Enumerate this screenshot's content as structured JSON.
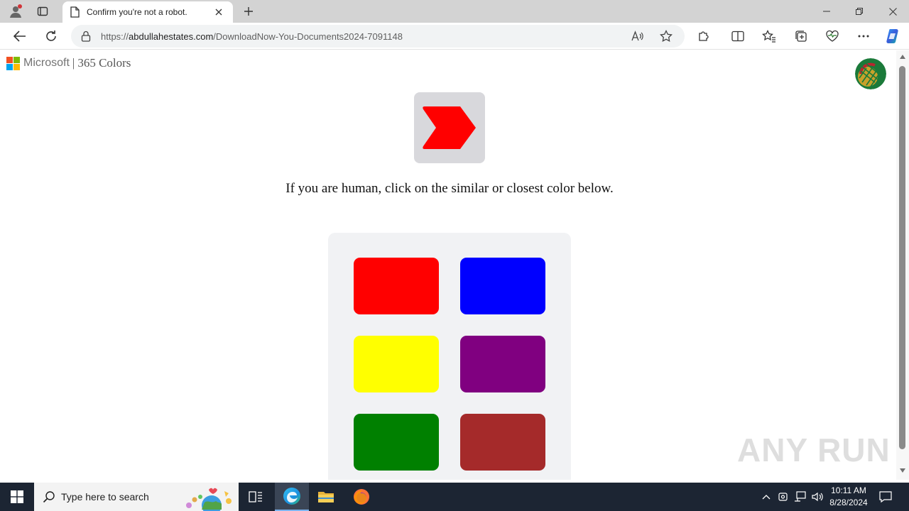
{
  "browser": {
    "tab": {
      "title": "Confirm you're not a robot."
    },
    "address": {
      "scheme": "https://",
      "domain": "abdullahestates.com",
      "path": "/DownloadNow-You-Documents2024-7091148"
    }
  },
  "page": {
    "brand": {
      "microsoft": "Microsoft",
      "separator": "|",
      "product": "365 Colors"
    },
    "prompt": "If you are human, click on the similar or closest color below.",
    "target_color": "#ff0000",
    "swatches": [
      {
        "color": "#ff0000"
      },
      {
        "color": "#0000ff"
      },
      {
        "color": "#ffff00"
      },
      {
        "color": "#800080"
      },
      {
        "color": "#008000"
      },
      {
        "color": "#a52a2a"
      }
    ],
    "watermark": "ANY RUN"
  },
  "taskbar": {
    "search_placeholder": "Type here to search",
    "time": "10:11 AM",
    "date": "8/28/2024"
  },
  "colors": {
    "accent": "#0078d4",
    "taskbar": "#1c2533",
    "ms_red": "#f25022",
    "ms_green": "#7fba00",
    "ms_blue": "#00a4ef",
    "ms_yellow": "#ffb900"
  }
}
